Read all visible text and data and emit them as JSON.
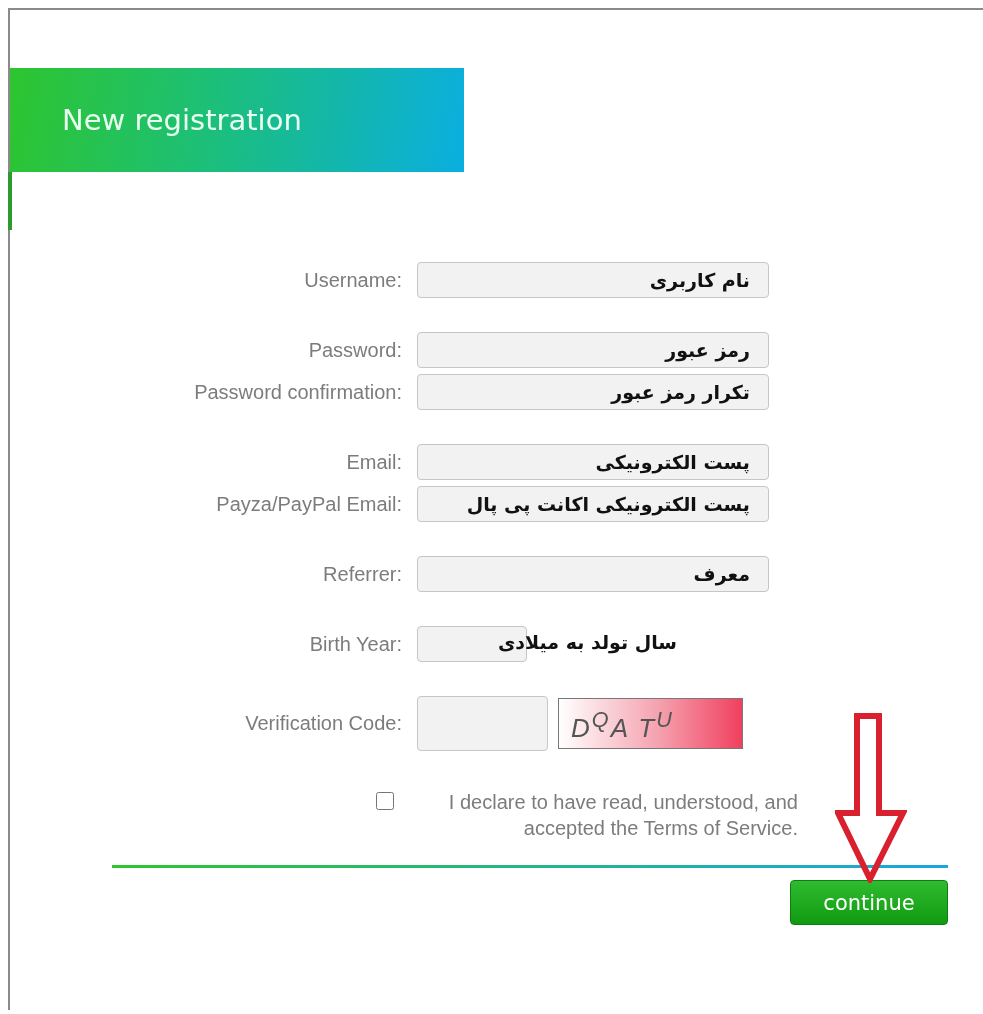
{
  "header": {
    "title": "New registration"
  },
  "groups": [
    [
      {
        "label": "Username:",
        "annotation": "نام کاربری",
        "kind": "text"
      }
    ],
    [
      {
        "label": "Password:",
        "annotation": "رمز عبور",
        "kind": "text"
      },
      {
        "label": "Password confirmation:",
        "annotation": "تکرار رمز عبور",
        "kind": "text"
      }
    ],
    [
      {
        "label": "Email:",
        "annotation": "پست الکترونیکی",
        "kind": "text"
      },
      {
        "label": "Payza/PayPal Email:",
        "annotation": "پست الکترونیکی اکانت پی پال",
        "kind": "text"
      }
    ],
    [
      {
        "label": "Referrer:",
        "annotation": "معرف",
        "kind": "text"
      }
    ],
    [
      {
        "label": "Birth Year:",
        "annotation": "سال تولد به میلادی",
        "kind": "short"
      }
    ],
    [
      {
        "label": "Verification Code:",
        "kind": "captcha",
        "captcha": "D$^{Q}$A T$^{U}$"
      }
    ]
  ],
  "terms": {
    "checked": false,
    "text": "I declare to have read, understood, and accepted the Terms of Service."
  },
  "continue_button": "continue"
}
